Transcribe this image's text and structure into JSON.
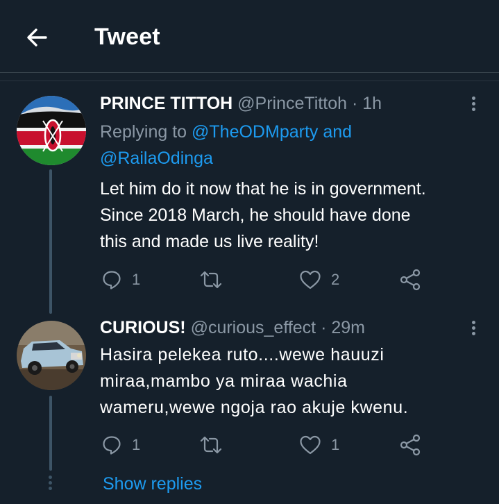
{
  "header": {
    "title": "Tweet",
    "back_icon": "arrow-left-icon"
  },
  "colors": {
    "background": "#15202b",
    "accent": "#1d9bf0",
    "muted": "#8b98a5",
    "divider": "#38444d"
  },
  "tweets": [
    {
      "name": "PRINCE TITTOH",
      "handle": "@PrinceTittoh",
      "separator": "·",
      "time": "1h",
      "replying_label": "Replying to",
      "reply_mention_1": "@TheODMparty",
      "reply_and": "and",
      "reply_mention_2": "@RailaOdinga",
      "text_lines": [
        "Let him do it now that he is in government.",
        "Since 2018 March, he should have done",
        "this and made us live reality!"
      ],
      "reply_count": "1",
      "retweet_count": "",
      "like_count": "2",
      "avatar": "kenya-flag-avatar"
    },
    {
      "name": "CURIOUS!",
      "handle": "@curious_effect",
      "separator": "·",
      "time": "29m",
      "text_lines": [
        "Hasira pelekea ruto....wewe hauuzi",
        "miraa,mambo ya miraa wachia",
        "wameru,wewe ngoja rao akuje kwenu."
      ],
      "reply_count": "1",
      "retweet_count": "",
      "like_count": "1",
      "avatar": "car-photo-avatar"
    }
  ],
  "show_replies": "Show replies"
}
